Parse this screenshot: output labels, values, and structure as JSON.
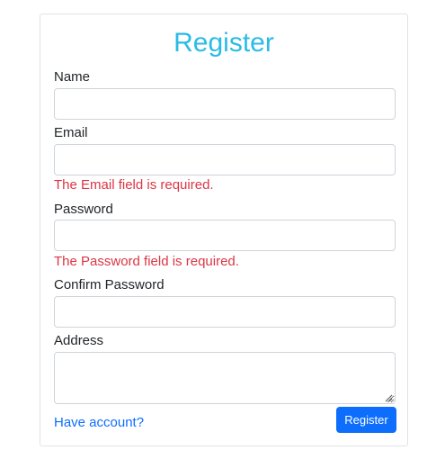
{
  "form": {
    "title": "Register",
    "fields": {
      "name": {
        "label": "Name",
        "value": "",
        "placeholder": ""
      },
      "email": {
        "label": "Email",
        "value": "",
        "placeholder": "",
        "error": "The Email field is required."
      },
      "password": {
        "label": "Password",
        "value": "",
        "placeholder": "",
        "error": "The Password field is required."
      },
      "confirm_password": {
        "label": "Confirm Password",
        "value": "",
        "placeholder": ""
      },
      "address": {
        "label": "Address",
        "value": "",
        "placeholder": ""
      }
    },
    "have_account_link": "Have account?",
    "submit_label": "Register"
  },
  "colors": {
    "title": "#2bbbe6",
    "error": "#dc3545",
    "primary": "#0d6efd",
    "border": "#ced4da"
  }
}
